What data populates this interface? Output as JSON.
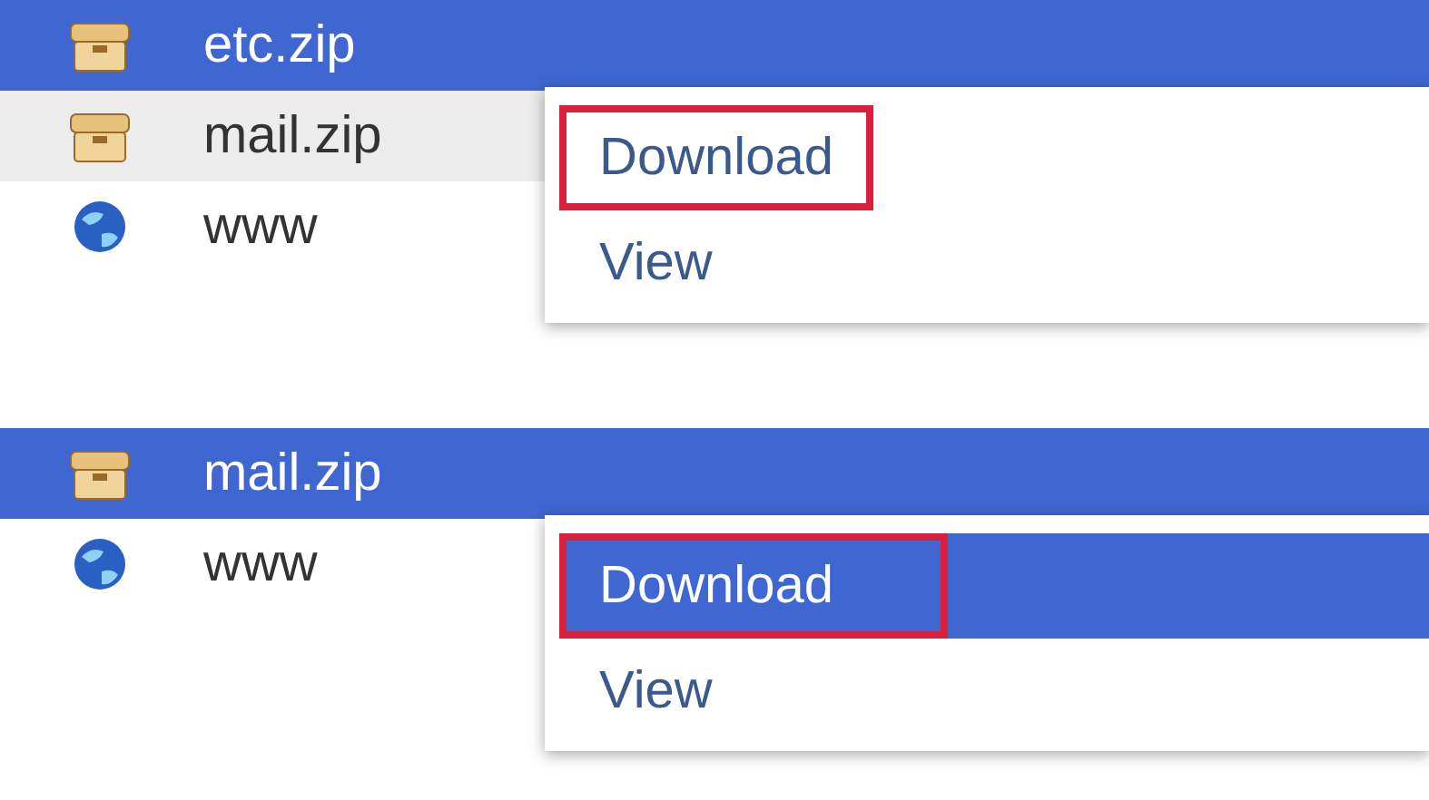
{
  "panels": [
    {
      "rows": [
        {
          "name": "etc.zip",
          "kind": "archive",
          "selected": true,
          "hovered": false
        },
        {
          "name": "mail.zip",
          "kind": "archive",
          "selected": false,
          "hovered": true
        },
        {
          "name": "www",
          "kind": "globe",
          "selected": false,
          "hovered": false
        }
      ],
      "menu": {
        "items": [
          {
            "label": "Download",
            "selected": false,
            "outlined": true
          },
          {
            "label": "View",
            "selected": false,
            "outlined": false
          }
        ]
      }
    },
    {
      "rows": [
        {
          "name": "mail.zip",
          "kind": "archive",
          "selected": true,
          "hovered": false
        },
        {
          "name": "www",
          "kind": "globe",
          "selected": false,
          "hovered": false
        }
      ],
      "menu": {
        "items": [
          {
            "label": "Download",
            "selected": true,
            "outlined": true
          },
          {
            "label": "View",
            "selected": false,
            "outlined": false
          }
        ]
      }
    }
  ]
}
